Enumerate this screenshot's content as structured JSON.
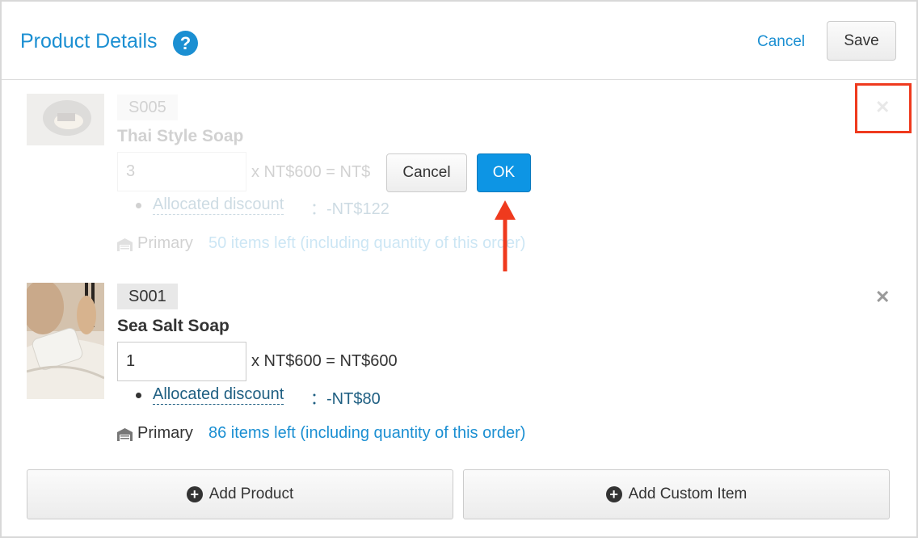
{
  "header": {
    "title": "Product Details",
    "help_icon": "question-circle-icon",
    "cancel_label": "Cancel",
    "save_label": "Save"
  },
  "confirm": {
    "cancel_label": "Cancel",
    "ok_label": "OK"
  },
  "products": [
    {
      "sku": "S005",
      "name": "Thai Style Soap",
      "quantity": "3",
      "calc": "x NT$600 = NT$",
      "discount_label": "Allocated discount",
      "discount_value": "：-NT$122",
      "warehouse_icon": "warehouse-icon",
      "warehouse_name": "Primary",
      "stock_text": "50 items left (including quantity of this order)",
      "state": "pending-removal"
    },
    {
      "sku": "S001",
      "name": "Sea Salt Soap",
      "quantity": "1",
      "calc": "x NT$600 = NT$600",
      "discount_label": "Allocated discount",
      "discount_value": "：-NT$80",
      "warehouse_icon": "warehouse-icon",
      "warehouse_name": "Primary",
      "stock_text": "86 items left (including quantity of this order)",
      "state": "active"
    }
  ],
  "actions": {
    "add_product_label": "Add Product",
    "add_custom_label": "Add Custom Item",
    "plus_icon": "plus-circle-icon"
  },
  "colors": {
    "accent": "#1b8fd2",
    "ok_button": "#0d95e4",
    "annotation": "#ef3a1e"
  }
}
